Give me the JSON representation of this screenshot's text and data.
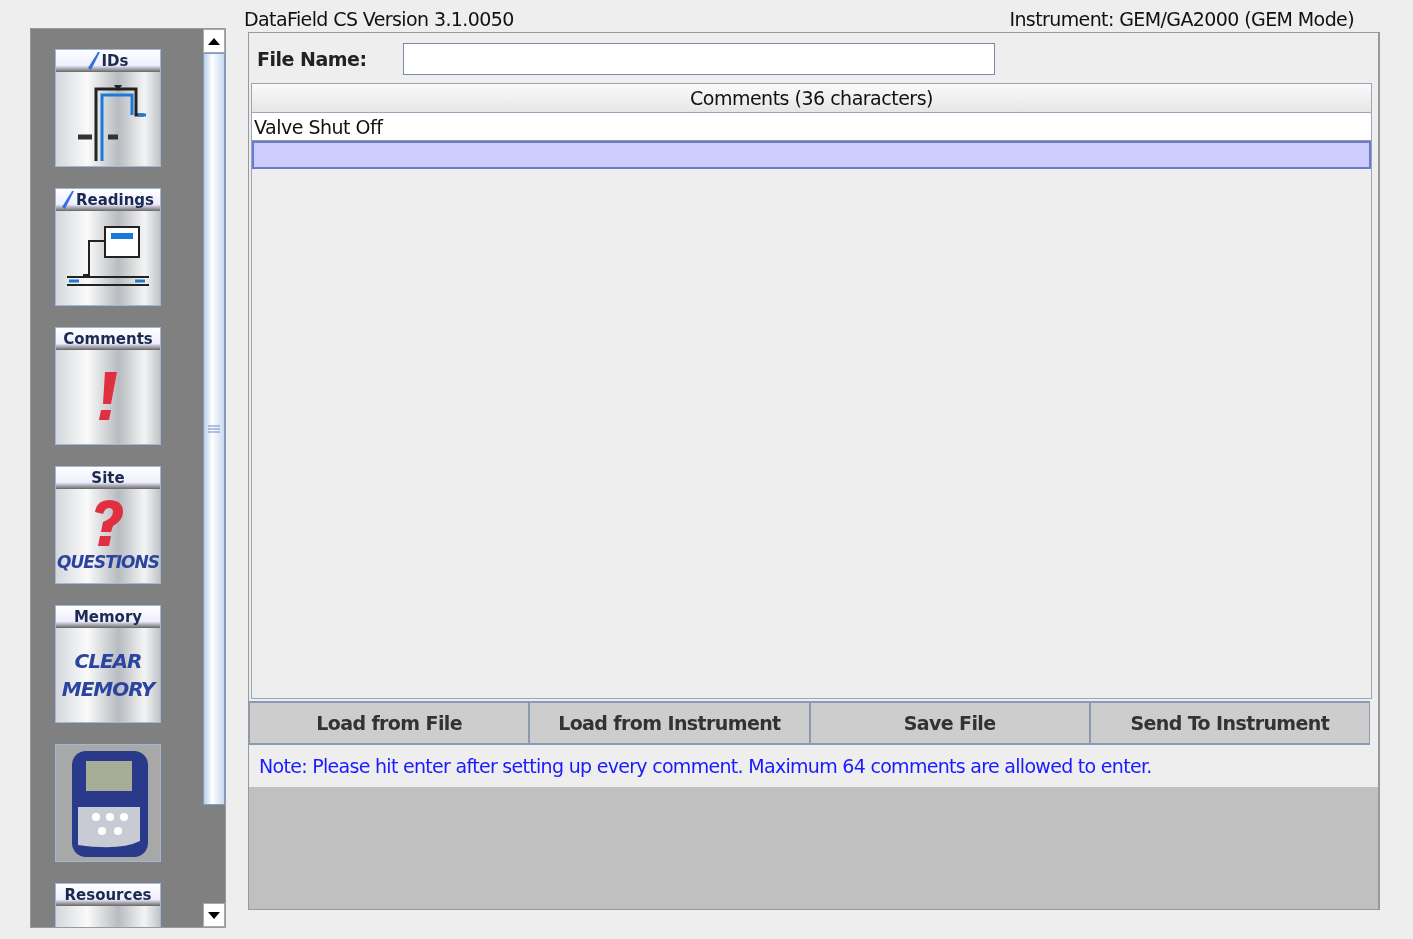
{
  "header": {
    "version": "DataField CS Version 3.1.0050",
    "instrument": "Instrument: GEM/GA2000 (GEM Mode)"
  },
  "sidebar": {
    "tiles": [
      {
        "label": "IDs",
        "checked": true,
        "kind": "pipes"
      },
      {
        "label": "Readings",
        "checked": true,
        "kind": "meter"
      },
      {
        "label": "Comments",
        "checked": false,
        "kind": "exclamation"
      },
      {
        "label": "Site",
        "checked": false,
        "kind": "question",
        "art_text": [
          "QUESTIONS"
        ]
      },
      {
        "label": "Memory",
        "checked": false,
        "kind": "clear",
        "art_text": [
          "CLEAR",
          "MEMORY"
        ]
      },
      {
        "kind": "device"
      },
      {
        "label": "Resources",
        "checked": false,
        "kind": "blank"
      }
    ]
  },
  "file_name": {
    "label": "File Name:"
  },
  "table": {
    "columns": [
      "Comments (36 characters)"
    ],
    "rows": [
      {
        "text": "Valve Shut Off",
        "selected": false
      },
      {
        "selected": true
      }
    ]
  },
  "buttons": [
    "Load from File",
    "Load from Instrument",
    "Save File",
    "Send To Instrument"
  ],
  "note": "Note: Please hit enter after setting up every comment. Maximum 64 comments are allowed to enter."
}
